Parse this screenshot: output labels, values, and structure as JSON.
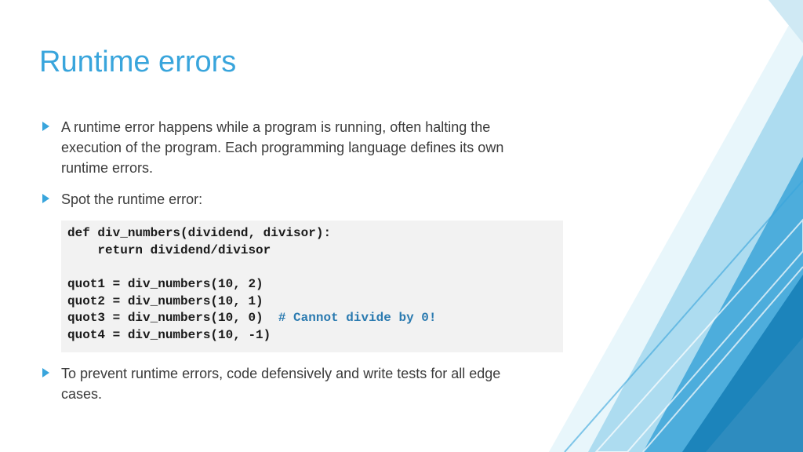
{
  "title": "Runtime errors",
  "bullets": {
    "b1": "A runtime error happens while a program is running, often halting the execution of the program. Each programming language defines its own runtime errors.",
    "b2": "Spot the runtime error:",
    "b3": "To prevent runtime errors, code defensively and write tests for all edge cases."
  },
  "code": {
    "l1": "def div_numbers(dividend, divisor):",
    "l2": "    return dividend/divisor",
    "l3": "",
    "l4": "quot1 = div_numbers(10, 2)",
    "l5": "quot2 = div_numbers(10, 1)",
    "l6a": "quot3 = div_numbers(10, 0)  ",
    "l6b": "# Cannot divide by 0!",
    "l7": "quot4 = div_numbers(10, -1)"
  }
}
